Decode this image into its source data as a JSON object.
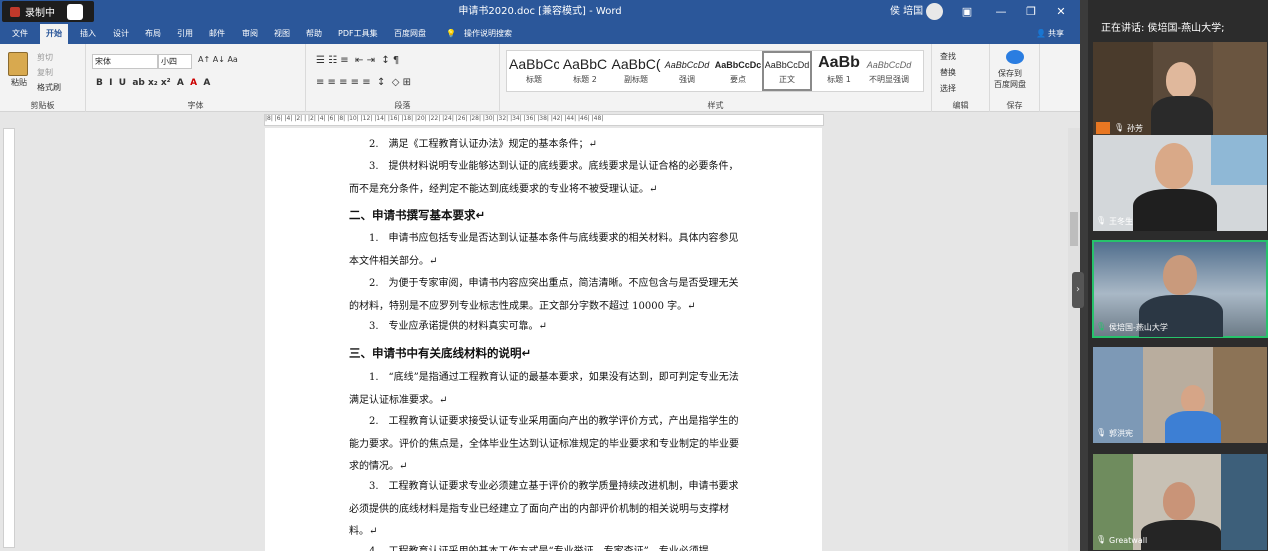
{
  "titlebar": {
    "recording_label": "录制中",
    "doc_title": "申请书2020.doc [兼容模式] - Word",
    "user_name": "侯 培国",
    "minimize": "—",
    "restore": "❐",
    "close": "✕"
  },
  "tabs": [
    "文件",
    "开始",
    "插入",
    "设计",
    "布局",
    "引用",
    "邮件",
    "审阅",
    "视图",
    "帮助",
    "PDF工具集",
    "百度网盘"
  ],
  "tell_me": "操作说明搜索",
  "share": "共享",
  "ribbon": {
    "clipboard": {
      "paste": "粘贴",
      "cut": "剪切",
      "copy": "复制",
      "format_painter": "格式刷",
      "group": "剪贴板"
    },
    "font": {
      "font_name": "宋体",
      "font_size": "小四",
      "group": "字体"
    },
    "paragraph": {
      "group": "段落"
    },
    "styles": {
      "group": "样式",
      "items": [
        {
          "preview": "AaBbCcl",
          "name": "标题"
        },
        {
          "preview": "AaBbC",
          "name": "标题 2"
        },
        {
          "preview": "AaBbC(",
          "name": "副标题"
        },
        {
          "preview": "AaBbCcDd",
          "name": "强调"
        },
        {
          "preview": "AaBbCcDc",
          "name": "要点"
        },
        {
          "preview": "AaBbCcDd",
          "name": "正文"
        },
        {
          "preview": "AaBb",
          "name": "标题 1"
        },
        {
          "preview": "AaBbCcDd",
          "name": "不明显强调"
        }
      ]
    },
    "editing": {
      "find": "查找",
      "replace": "替换",
      "select": "选择",
      "group": "编辑"
    },
    "save": {
      "label1": "保存到",
      "label2": "百度网盘",
      "group": "保存"
    }
  },
  "ruler_text": "|8| |6| |4| |2| |    |2| |4| |6| |8| |10| |12| |14| |16| |18| |20| |22| |24| |26| |28| |30| |32| |34| |36| |38|     |42| |44| |46| |48|",
  "document": {
    "p1": "2.　满足《工程教育认证办法》规定的基本条件；↵",
    "p2": "3.　提供材料说明专业能够达到认证的底线要求。底线要求是认证合格的必要条件，而不是充分条件，经判定不能达到底线要求的专业将不被受理认证。↵",
    "h2": "二、申请书撰写基本要求↵",
    "p3": "1.　申请书应包括专业是否达到认证基本条件与底线要求的相关材料。具体内容参见本文件相关部分。↵",
    "p4": "2.　为便于专家审阅，申请书内容应突出重点，简洁清晰。不应包含与是否受理无关的材料，特别是不应罗列专业标志性成果。正文部分字数不超过 10000 字。↵",
    "p5": "3.　专业应承诺提供的材料真实可靠。↵",
    "h3": "三、申请书中有关底线材料的说明↵",
    "p6": "1.　“底线”是指通过工程教育认证的最基本要求，如果没有达到，即可判定专业无法满足认证标准要求。↵",
    "p7": "2.　工程教育认证要求接受认证专业采用面向产出的教学评价方式，产出是指学生的能力要求。评价的焦点是，全体毕业生达到认证标准规定的毕业要求和专业制定的毕业要求的情况。↵",
    "p8": "3.　工程教育认证要求专业必须建立基于评价的教学质量持续改进机制，申请书要求必须提供的底线材料是指专业已经建立了面向产出的内部评价机制的相关说明与支撑材料。↵",
    "p9": "4.　工程教育认证采用的基本工作方式是“专业举证，专家查证”，专业必须提"
  },
  "meeting": {
    "speaking": "正在讲话: 侯培国-燕山大学;",
    "participants": [
      {
        "name": "孙芳"
      },
      {
        "name": "王冬生"
      },
      {
        "name": "侯培国-燕山大学"
      },
      {
        "name": "郭洪宪"
      },
      {
        "name": "Greatwall"
      }
    ]
  },
  "colors": {
    "word_blue": "#2b579a",
    "active_tile": "#27c26b"
  }
}
